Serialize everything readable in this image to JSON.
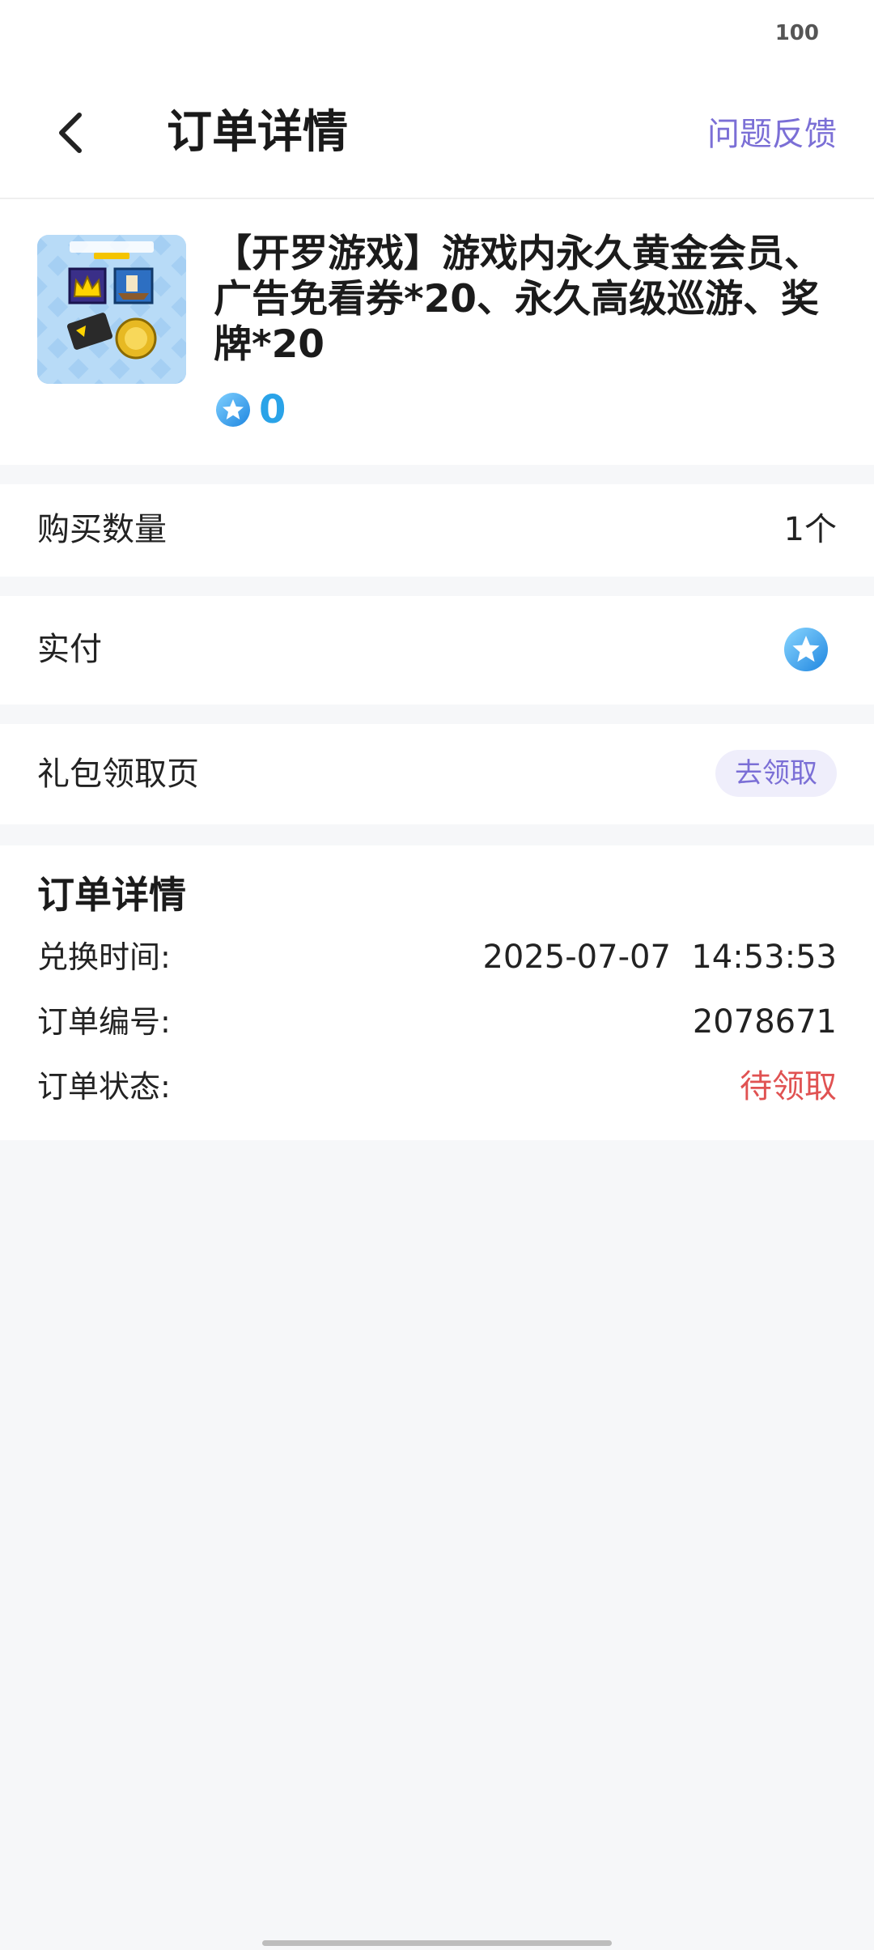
{
  "status_bar": {
    "battery": "100"
  },
  "header": {
    "title": "订单详情",
    "feedback_label": "问题反馈"
  },
  "product": {
    "title": "【开罗游戏】游戏内永久黄金会员、广告免看券*20、永久高级巡游、奖牌*20",
    "price": "0"
  },
  "rows": {
    "quantity_label": "购买数量",
    "quantity_value": "1个",
    "paid_label": "实付",
    "gift_label": "礼包领取页",
    "claim_button": "去领取"
  },
  "details": {
    "title": "订单详情",
    "time_label": "兑换时间:",
    "time_value": "2025-07-07  14:53:53",
    "id_label": "订单编号:",
    "id_value": "2078671",
    "status_label": "订单状态:",
    "status_value": "待领取"
  },
  "colors": {
    "accent": "#7b6fd6",
    "price": "#2aa3e8",
    "status": "#e05252",
    "background": "#f6f7f9"
  },
  "icons": {
    "back": "chevron-left-icon",
    "coin": "star-coin-icon"
  }
}
